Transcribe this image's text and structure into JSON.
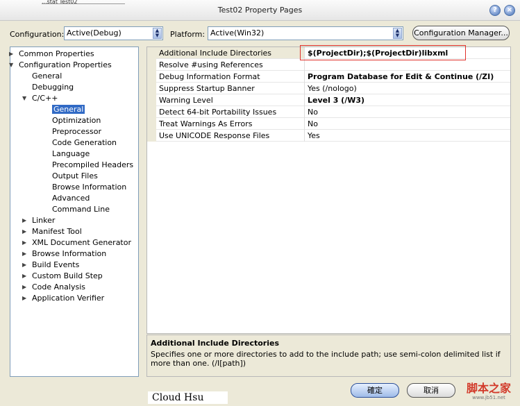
{
  "window": {
    "title": "Test02 Property Pages",
    "prev_tab_text": "...stat   Test02",
    "help_button": "?",
    "close_button": "×"
  },
  "toolbar": {
    "configuration_label": "Configuration:",
    "configuration_value": "Active(Debug)",
    "platform_label": "Platform:",
    "platform_value": "Active(Win32)",
    "config_manager_label": "Configuration Manager..."
  },
  "tree": {
    "items": [
      {
        "label": "Common Properties",
        "level": 0,
        "twisty": "closed"
      },
      {
        "label": "Configuration Properties",
        "level": 0,
        "twisty": "open"
      },
      {
        "label": "General",
        "level": 1,
        "twisty": "none"
      },
      {
        "label": "Debugging",
        "level": 1,
        "twisty": "none"
      },
      {
        "label": "C/C++",
        "level": 1,
        "twisty": "open"
      },
      {
        "label": "General",
        "level": 2,
        "twisty": "none",
        "selected": true
      },
      {
        "label": "Optimization",
        "level": 2,
        "twisty": "none"
      },
      {
        "label": "Preprocessor",
        "level": 2,
        "twisty": "none"
      },
      {
        "label": "Code Generation",
        "level": 2,
        "twisty": "none"
      },
      {
        "label": "Language",
        "level": 2,
        "twisty": "none"
      },
      {
        "label": "Precompiled Headers",
        "level": 2,
        "twisty": "none"
      },
      {
        "label": "Output Files",
        "level": 2,
        "twisty": "none"
      },
      {
        "label": "Browse Information",
        "level": 2,
        "twisty": "none"
      },
      {
        "label": "Advanced",
        "level": 2,
        "twisty": "none"
      },
      {
        "label": "Command Line",
        "level": 2,
        "twisty": "none"
      },
      {
        "label": "Linker",
        "level": 1,
        "twisty": "closed"
      },
      {
        "label": "Manifest Tool",
        "level": 1,
        "twisty": "closed"
      },
      {
        "label": "XML Document Generator",
        "level": 1,
        "twisty": "closed"
      },
      {
        "label": "Browse Information",
        "level": 1,
        "twisty": "closed"
      },
      {
        "label": "Build Events",
        "level": 1,
        "twisty": "closed"
      },
      {
        "label": "Custom Build Step",
        "level": 1,
        "twisty": "closed"
      },
      {
        "label": "Code Analysis",
        "level": 1,
        "twisty": "closed"
      },
      {
        "label": "Application Verifier",
        "level": 1,
        "twisty": "closed"
      }
    ]
  },
  "properties": {
    "rows": [
      {
        "name": "Additional Include Directories",
        "value": "$(ProjectDir);$(ProjectDir)libxml",
        "bold": true,
        "selected": true
      },
      {
        "name": "Resolve #using References",
        "value": "",
        "bold": false
      },
      {
        "name": "Debug Information Format",
        "value": "Program Database for Edit & Continue (/ZI)",
        "bold": true
      },
      {
        "name": "Suppress Startup Banner",
        "value": "Yes (/nologo)",
        "bold": false
      },
      {
        "name": "Warning Level",
        "value": "Level 3 (/W3)",
        "bold": true
      },
      {
        "name": "Detect 64-bit Portability Issues",
        "value": "No",
        "bold": false
      },
      {
        "name": "Treat Warnings As Errors",
        "value": "No",
        "bold": false
      },
      {
        "name": "Use UNICODE Response Files",
        "value": "Yes",
        "bold": false
      }
    ]
  },
  "description": {
    "title": "Additional Include Directories",
    "text": "Specifies one or more directories to add to the include path; use semi-colon delimited list if more than one.    (/I[path])"
  },
  "buttons": {
    "ok": "確定",
    "cancel": "取消"
  },
  "overlay": {
    "caption": "Cloud Hsu",
    "watermark_main": "脚本之家",
    "watermark_url": "www.jb51.net"
  }
}
